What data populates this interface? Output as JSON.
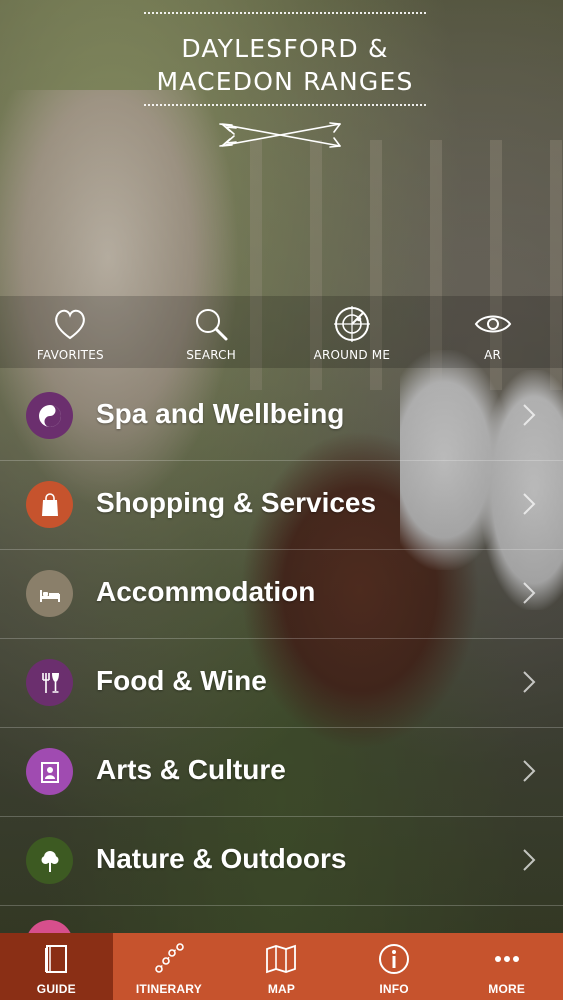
{
  "brand": {
    "line1": "DAYLESFORD &",
    "line2": "MACEDON RANGES"
  },
  "quick_actions": [
    {
      "label": "FAVORITES",
      "icon": "heart-icon"
    },
    {
      "label": "SEARCH",
      "icon": "search-icon"
    },
    {
      "label": "AROUND ME",
      "icon": "radar-icon"
    },
    {
      "label": "AR",
      "icon": "eye-icon"
    }
  ],
  "categories": [
    {
      "label": "Spa and Wellbeing",
      "icon": "yin-yang-icon",
      "color": "#6b2f6e"
    },
    {
      "label": "Shopping & Services",
      "icon": "shopping-bag-icon",
      "color": "#c6532d"
    },
    {
      "label": "Accommodation",
      "icon": "bed-icon",
      "color": "#8a7f6a"
    },
    {
      "label": "Food & Wine",
      "icon": "fork-glass-icon",
      "color": "#6b2f6e"
    },
    {
      "label": "Arts & Culture",
      "icon": "portrait-frame-icon",
      "color": "#a04bb1"
    },
    {
      "label": "Nature & Outdoors",
      "icon": "tree-icon",
      "color": "#3d5a22"
    }
  ],
  "tabs": [
    {
      "label": "GUIDE",
      "icon": "book-icon",
      "active": true
    },
    {
      "label": "ITINERARY",
      "icon": "route-icon",
      "active": false
    },
    {
      "label": "MAP",
      "icon": "map-icon",
      "active": false
    },
    {
      "label": "INFO",
      "icon": "info-icon",
      "active": false
    },
    {
      "label": "MORE",
      "icon": "more-dots-icon",
      "active": false
    }
  ],
  "colors": {
    "tabbar": "#c6532d",
    "tab_active": "#8a2f15",
    "peek_category": "#d64f8c"
  }
}
